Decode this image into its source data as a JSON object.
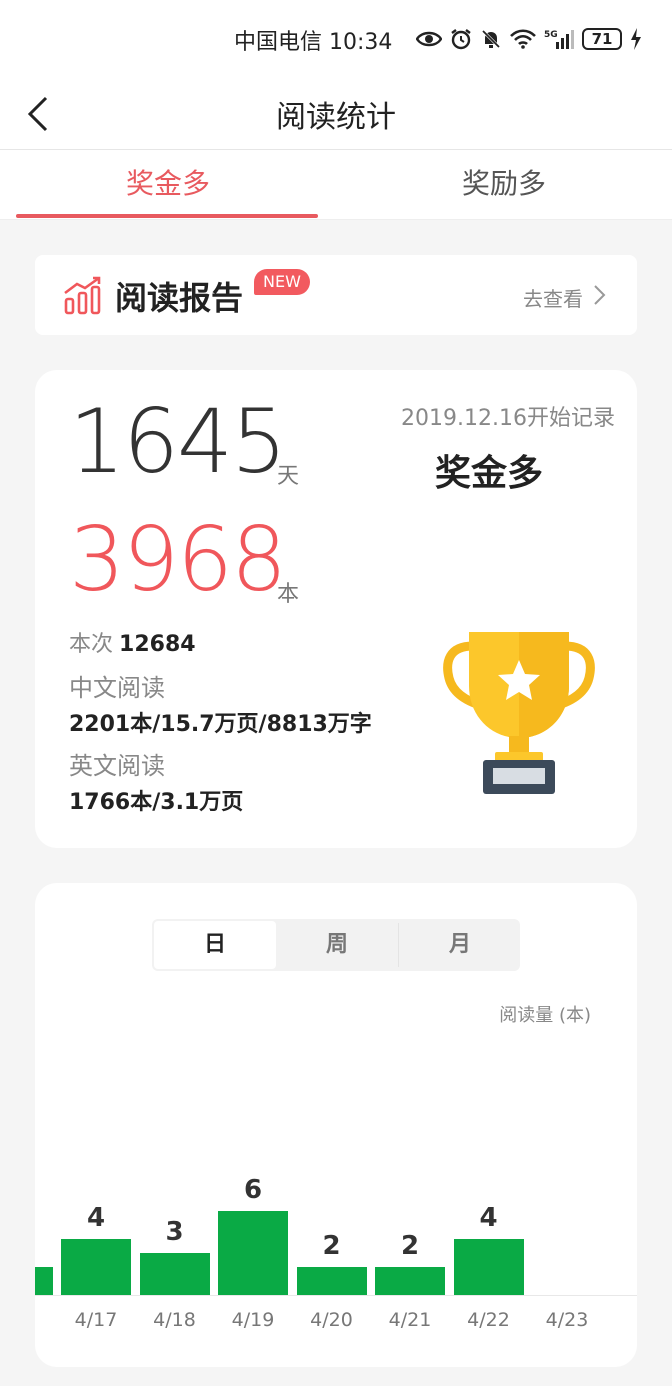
{
  "status_bar": {
    "carrier_time": "中国电信 10:34",
    "battery": "71",
    "icons": [
      "eye-icon",
      "alarm-icon",
      "mute-icon",
      "wifi-icon",
      "5g-signal-icon",
      "charging-icon"
    ]
  },
  "header": {
    "title": "阅读统计",
    "back_icon": "chevron-left-icon"
  },
  "tabs": [
    {
      "label": "奖金多",
      "active": true
    },
    {
      "label": "奖励多",
      "active": false
    }
  ],
  "report": {
    "label": "阅读报告",
    "badge": "NEW",
    "action": "去查看",
    "icon": "bar-chart-icon"
  },
  "summary": {
    "days": "1645",
    "days_unit": "天",
    "books": "3968",
    "books_unit": "本",
    "since": "2019.12.16开始记录",
    "app_name": "奖金多",
    "times_label": "本次",
    "times_value": "12684",
    "chinese_label": "中文阅读",
    "chinese_value": "2201本/15.7万页/8813万字",
    "english_label": "英文阅读",
    "english_value": "1766本/3.1万页",
    "trophy_icon": "trophy-icon"
  },
  "chart_toggle": {
    "items": [
      "日",
      "周",
      "月"
    ],
    "active_index": 0
  },
  "chart_unit": "阅读量 (本)",
  "chart_data": {
    "type": "bar",
    "categories": [
      "4/17",
      "4/18",
      "4/19",
      "4/20",
      "4/21",
      "4/22",
      "4/23"
    ],
    "values": [
      4,
      3,
      6,
      2,
      2,
      4,
      0
    ],
    "partial_previous_value": 2,
    "ylabel": "阅读量 (本)",
    "bar_color": "#0aaa45"
  },
  "colors": {
    "accent": "#e85a5f",
    "bar": "#0aaa45"
  }
}
